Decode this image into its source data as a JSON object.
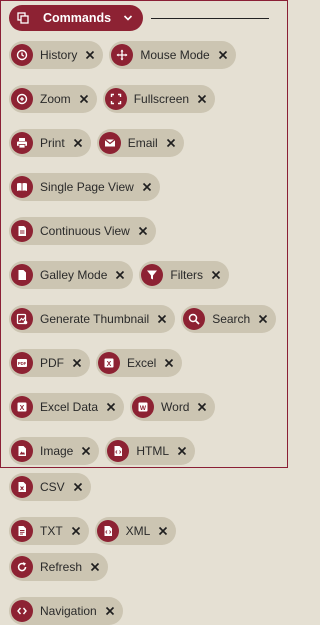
{
  "header": {
    "commands_label": "Commands"
  },
  "chips": [
    {
      "label": "History",
      "icon": "history-icon"
    },
    {
      "label": "Mouse Mode",
      "icon": "move-icon"
    },
    {
      "label": "Zoom",
      "icon": "zoom-icon"
    },
    {
      "label": "Fullscreen",
      "icon": "fullscreen-icon"
    },
    {
      "label": "Print",
      "icon": "print-icon"
    },
    {
      "label": "Email",
      "icon": "email-icon"
    },
    {
      "label": "Single Page View",
      "icon": "single-page-icon"
    },
    {
      "label": "Continuous View",
      "icon": "continuous-view-icon"
    },
    {
      "label": "Galley Mode",
      "icon": "galley-icon"
    },
    {
      "label": "Filters",
      "icon": "filter-icon"
    },
    {
      "label": "Generate Thumbnail",
      "icon": "thumbnail-icon"
    },
    {
      "label": "Search",
      "icon": "search-icon"
    },
    {
      "label": "PDF",
      "icon": "pdf-icon"
    },
    {
      "label": "Excel",
      "icon": "excel-icon"
    },
    {
      "label": "Excel Data",
      "icon": "excel-data-icon"
    },
    {
      "label": "Word",
      "icon": "word-icon"
    },
    {
      "label": "Image",
      "icon": "image-icon"
    },
    {
      "label": "HTML",
      "icon": "html-icon"
    },
    {
      "label": "CSV",
      "icon": "csv-icon"
    },
    {
      "label": "TXT",
      "icon": "txt-icon"
    },
    {
      "label": "XML",
      "icon": "xml-icon"
    },
    {
      "label": "Refresh",
      "icon": "refresh-icon"
    },
    {
      "label": "Navigation",
      "icon": "navigation-icon"
    }
  ],
  "colors": {
    "accent": "#8d2233",
    "chip_bg": "#ccc5b2",
    "background": "#e5e0d3"
  }
}
